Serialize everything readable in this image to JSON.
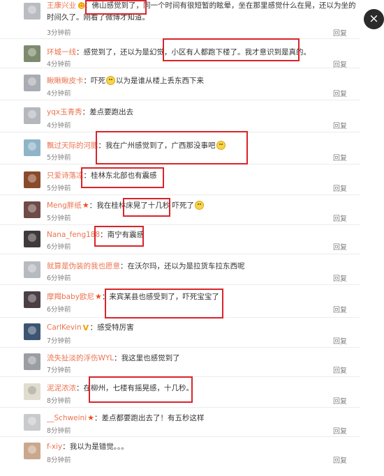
{
  "close_icon": "×",
  "reply_label": "回复",
  "comments": [
    {
      "user": "王康兴业",
      "sep": "：",
      "text": "佛山感觉到了，同一个时间有很短暂的眩晕，坐在那里感觉什么在晃，还以为坐的",
      "text2": "时间久了。刚看了微博才知道。",
      "time": "3分钟前",
      "avatar_color": "#b9bcc0"
    },
    {
      "user": "环城一线",
      "sep": "：",
      "text": "感觉到了，还以为是幻觉，小区有人都跑下楼了。我才意识到是真的。",
      "time": "4分钟前",
      "avatar_color": "#7d8a6e"
    },
    {
      "user": "瞅瞅瞅皮卡",
      "sep": "：",
      "text": "吓死",
      "text_after": "以为是谁从楼上丢东西下来",
      "time": "4分钟前",
      "avatar_color": "#a9acb2"
    },
    {
      "user": "yqx玉青秀",
      "sep": "：",
      "text": "差点要跑出去",
      "time": "4分钟前",
      "avatar_color": "#b4b8bd"
    },
    {
      "user": "飘过天际的河豚",
      "sep": "：",
      "text": "我在广州感觉到了，广西那没事吧",
      "time": "5分钟前",
      "avatar_color": "#8fb4c8"
    },
    {
      "user": "只爱诗落凉",
      "sep": "：",
      "text": "桂林东北部也有震感",
      "time": "5分钟前",
      "avatar_color": "#8a4a2c"
    },
    {
      "user": "Meng胖纸",
      "sep": "：",
      "text": "我在桂林床晃了十几秒  吓死了",
      "time": "5分钟前",
      "avatar_color": "#6e4b47"
    },
    {
      "user": "Nana_feng188",
      "sep": "：",
      "text": "南宁有震感",
      "time": "6分钟前",
      "avatar_color": "#3f3a3a"
    },
    {
      "user": "就算是伪装的我也愿意",
      "sep": "：",
      "text": "在沃尔玛，还以为是拉货车拉东西呢",
      "time": "6分钟前",
      "avatar_color": "#b7babf"
    },
    {
      "user": "摩羯baby欧尼",
      "sep": "：",
      "text": "来宾某县也感受到了，吓死宝宝了",
      "time": "6分钟前",
      "avatar_color": "#4b3f45"
    },
    {
      "user": "CarlKevin",
      "sep": "：",
      "text": "感受特厉害",
      "time": "7分钟前",
      "avatar_color": "#3d5571"
    },
    {
      "user": "流失扯淡的浮伤WYL",
      "sep": "：",
      "text": "我这里也感觉到了",
      "time": "7分钟前",
      "avatar_color": "#9a9da2"
    },
    {
      "user": "泥泥浓浓",
      "sep": "：",
      "text": "在柳州，七楼有摇晃感，十几秒。",
      "time": "8分钟前",
      "avatar_color": "#e0dccf"
    },
    {
      "user": "__Schweini",
      "sep": "：",
      "text": "差点都要跑出去了！有五秒这样",
      "time": "8分钟前",
      "avatar_color": "#c9cacd"
    },
    {
      "user": "f-xiy",
      "sep": "：",
      "text": "我以为是错觉。。。",
      "time": "8分钟前",
      "avatar_color": "#c9a88e"
    }
  ]
}
